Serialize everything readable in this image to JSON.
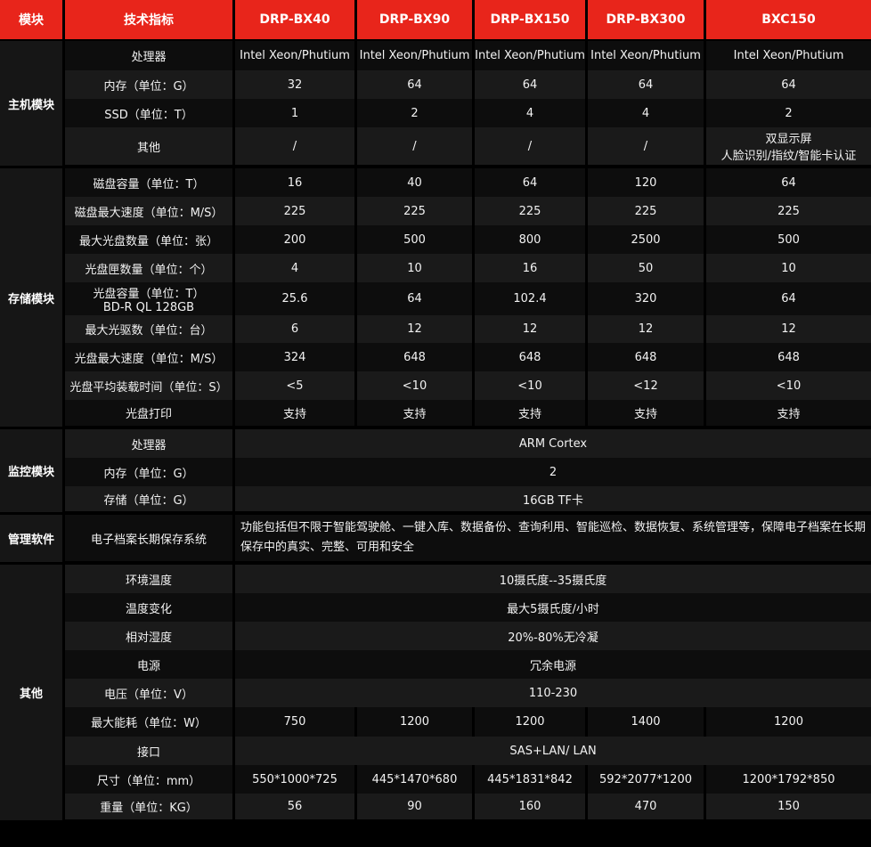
{
  "header": [
    "模块",
    "技术指标",
    "DRP-BX40",
    "DRP-BX90",
    "DRP-BX150",
    "DRP-BX300",
    "BXC150"
  ],
  "sections": [
    {
      "name": "主机模块",
      "rows": [
        {
          "label": "处理器",
          "values": [
            "Intel Xeon/Phutium",
            "Intel Xeon/Phutium",
            "Intel Xeon/Phutium",
            "Intel Xeon/Phutium",
            "Intel Xeon/Phutium"
          ]
        },
        {
          "label": "内存（单位：G）",
          "values": [
            "32",
            "64",
            "64",
            "64",
            "64"
          ]
        },
        {
          "label": "SSD（单位：T）",
          "values": [
            "1",
            "2",
            "4",
            "4",
            "2"
          ]
        },
        {
          "label": "其他",
          "values": [
            "/",
            "/",
            "/",
            "/",
            "双显示屏\n人脸识别/指纹/智能卡认证"
          ]
        }
      ]
    },
    {
      "name": "存储模块",
      "rows": [
        {
          "label": "磁盘容量（单位：T）",
          "values": [
            "16",
            "40",
            "64",
            "120",
            "64"
          ]
        },
        {
          "label": "磁盘最大速度（单位：M/S）",
          "values": [
            "225",
            "225",
            "225",
            "225",
            "225"
          ]
        },
        {
          "label": "最大光盘数量（单位：张）",
          "values": [
            "200",
            "500",
            "800",
            "2500",
            "500"
          ]
        },
        {
          "label": "光盘匣数量（单位：个）",
          "values": [
            "4",
            "10",
            "16",
            "50",
            "10"
          ]
        },
        {
          "label": "光盘容量（单位：T）\nBD-R QL 128GB",
          "values": [
            "25.6",
            "64",
            "102.4",
            "320",
            "64"
          ]
        },
        {
          "label": "最大光驱数（单位：台）",
          "values": [
            "6",
            "12",
            "12",
            "12",
            "12"
          ]
        },
        {
          "label": "光盘最大速度（单位：M/S）",
          "values": [
            "324",
            "648",
            "648",
            "648",
            "648"
          ]
        },
        {
          "label": "光盘平均装载时间（单位：S）",
          "values": [
            "<5",
            "<10",
            "<10",
            "<12",
            "<10"
          ]
        },
        {
          "label": "光盘打印",
          "values": [
            "支持",
            "支持",
            "支持",
            "支持",
            "支持"
          ]
        }
      ]
    },
    {
      "name": "监控模块",
      "rows": [
        {
          "label": "处理器",
          "span": "ARM Cortex"
        },
        {
          "label": "内存（单位：G）",
          "span": "2"
        },
        {
          "label": "存储（单位：G）",
          "span": "16GB TF卡"
        }
      ]
    },
    {
      "name": "管理软件",
      "rows": [
        {
          "label": "电子档案长期保存系统",
          "span": "功能包括但不限于智能驾驶舱、一键入库、数据备份、查询利用、智能巡检、数据恢复、系统管理等，保障电子档案在长期保存中的真实、完整、可用和安全",
          "left": true
        }
      ]
    },
    {
      "name": "其他",
      "rows": [
        {
          "label": "环境温度",
          "span": "10摄氏度--35摄氏度"
        },
        {
          "label": "温度变化",
          "span": "最大5摄氏度/小时"
        },
        {
          "label": "相对湿度",
          "span": "20%-80%无冷凝"
        },
        {
          "label": "电源",
          "span": "冗余电源"
        },
        {
          "label": "电压（单位：V）",
          "span": "110-230"
        },
        {
          "label": "最大能耗（单位：W）",
          "values": [
            "750",
            "1200",
            "1200",
            "1400",
            "1200"
          ]
        },
        {
          "label": "接口",
          "span": "SAS+LAN/ LAN"
        },
        {
          "label": "尺寸（单位：mm）",
          "values": [
            "550*1000*725",
            "445*1470*680",
            "445*1831*842",
            "592*2077*1200",
            "1200*1792*850"
          ]
        },
        {
          "label": "重量（单位：KG）",
          "values": [
            "56",
            "90",
            "160",
            "470",
            "150"
          ]
        }
      ]
    }
  ],
  "colors": {
    "header_bg": "#e8251b",
    "row_dark": "#0d0d0d",
    "row_light": "#1a1a1a",
    "module_bg": "#161616"
  }
}
